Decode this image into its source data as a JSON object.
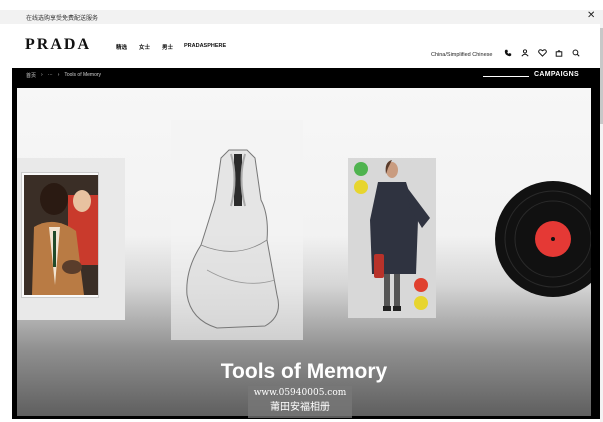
{
  "announcement": {
    "text": "在线选购享受免费配送服务"
  },
  "header": {
    "logo": "PRADA",
    "nav": [
      "精选",
      "女士",
      "男士",
      "PRADASPHERE"
    ],
    "language": "China/Simplified Chinese",
    "icons": [
      "phone-icon",
      "user-icon",
      "heart-icon",
      "bag-icon",
      "search-icon"
    ]
  },
  "breadcrumb": {
    "home": "首页",
    "ellipsis": "···",
    "current": "Tools of Memory",
    "separator": "›"
  },
  "campaigns": {
    "label": "CAMPAIGNS"
  },
  "hero": {
    "title": "Tools of Memory"
  },
  "watermark": {
    "line1": "www.05940005.com",
    "line2": "莆田安福相册"
  },
  "colors": {
    "accent": "#000000",
    "record_label": "#e53935"
  }
}
